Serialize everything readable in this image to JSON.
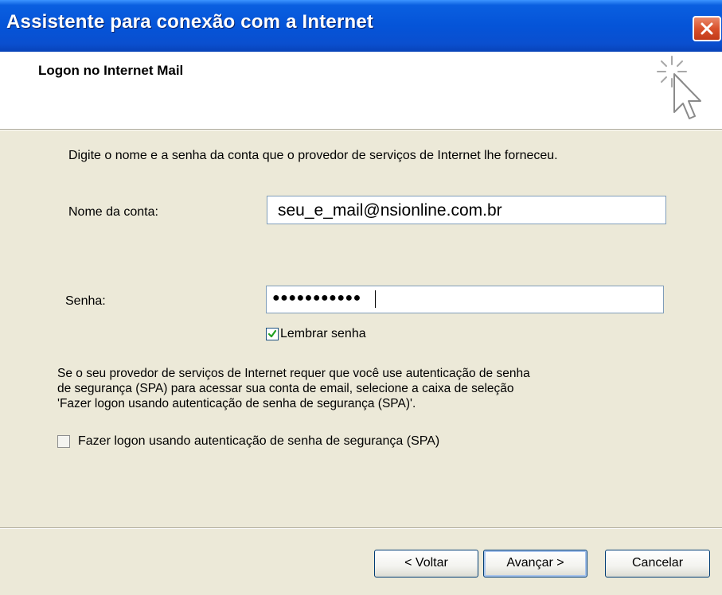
{
  "window": {
    "title": "Assistente para conexão com a Internet"
  },
  "header": {
    "title": "Logon no Internet Mail",
    "icon": "wizard-cursor-icon"
  },
  "intro": "Digite o nome e a senha da conta que o provedor de serviços de Internet lhe forneceu.",
  "account": {
    "label": "Nome da conta:",
    "value": "seu_e_mail@nsionline.com.br"
  },
  "password": {
    "label": "Senha:",
    "masked_value": "●●●●●●●●●●●"
  },
  "remember": {
    "label": "Lembrar senha",
    "checked": true
  },
  "spa": {
    "text_lines": [
      "Se o seu provedor de serviços de Internet requer que você use autenticação de senha",
      "de segurança (SPA) para acessar sua conta de email, selecione a caixa de seleção",
      "'Fazer logon usando autenticação de senha de segurança (SPA)'."
    ],
    "checkbox_label": "Fazer logon usando autenticação de senha de segurança (SPA)",
    "checked": false
  },
  "buttons": {
    "back": "< Voltar",
    "next": "Avançar >",
    "cancel": "Cancelar"
  },
  "colors": {
    "titlebar": "#0554d8",
    "close": "#d9512c",
    "dialog_bg": "#ece9d8"
  }
}
